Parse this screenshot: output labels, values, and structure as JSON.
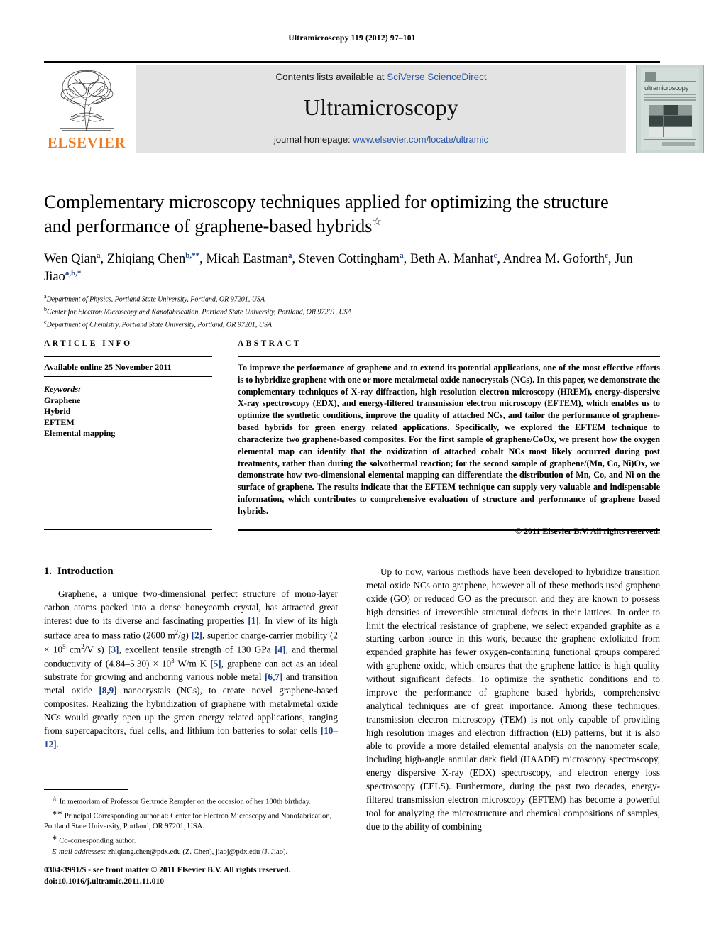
{
  "running_head": "Ultramicroscopy 119 (2012) 97–101",
  "masthead": {
    "contents_prefix": "Contents lists available at ",
    "contents_link": "SciVerse ScienceDirect",
    "journal_title": "Ultramicroscopy",
    "homepage_prefix": "journal homepage: ",
    "homepage_url": "www.elsevier.com/locate/ultramic",
    "publisher": "ELSEVIER",
    "publisher_color": "#ee7c24",
    "link_color": "#2b58a6",
    "cover": {
      "title": "ultramicroscopy",
      "subtitle": "a journal concerned with the problem of resolving atoms, molecules, tissues and structures in the microscopy"
    }
  },
  "article": {
    "title_line1": "Complementary microscopy techniques applied for optimizing the structure",
    "title_line2": "and performance of graphene-based hybrids",
    "title_footnote_mark": "☆",
    "authors": [
      {
        "name": "Wen Qian",
        "sup": "a",
        "sep": ", "
      },
      {
        "name": "Zhiqiang Chen",
        "sup": "b,**",
        "sep": ", "
      },
      {
        "name": "Micah Eastman",
        "sup": "a",
        "sep": ", "
      },
      {
        "name": "Steven Cottingham",
        "sup": "a",
        "sep": ", "
      },
      {
        "name": "Beth A. Manhat",
        "sup": "c",
        "sep": ", "
      },
      {
        "name": "Andrea M. Goforth",
        "sup": "c",
        "sep": ", "
      },
      {
        "name": "Jun Jiao",
        "sup": "a,b,*",
        "sep": ""
      }
    ],
    "affiliations": [
      {
        "mark": "a",
        "text": "Department of Physics, Portland State University, Portland, OR 97201, USA"
      },
      {
        "mark": "b",
        "text": "Center for Electron Microscopy and Nanofabrication, Portland State University, Portland, OR 97201, USA"
      },
      {
        "mark": "c",
        "text": "Department of Chemistry, Portland State University, Portland, OR 97201, USA"
      }
    ]
  },
  "article_info": {
    "heading": "ARTICLE INFO",
    "available_online": "Available online 25 November 2011",
    "keywords_label": "Keywords:",
    "keywords": [
      "Graphene",
      "Hybrid",
      "EFTEM",
      "Elemental mapping"
    ]
  },
  "abstract": {
    "heading": "ABSTRACT",
    "text": "To improve the performance of graphene and to extend its potential applications, one of the most effective efforts is to hybridize graphene with one or more metal/metal oxide nanocrystals (NCs). In this paper, we demonstrate the complementary techniques of X-ray diffraction, high resolution electron microscopy (HREM), energy-dispersive X-ray spectroscopy (EDX), and energy-filtered transmission electron microscopy (EFTEM), which enables us to optimize the synthetic conditions, improve the quality of attached NCs, and tailor the performance of graphene-based hybrids for green energy related applications. Specifically, we explored the EFTEM technique to characterize two graphene-based composites. For the first sample of graphene/CoOx, we present how the oxygen elemental map can identify that the oxidization of attached cobalt NCs most likely occurred during post treatments, rather than during the solvothermal reaction; for the second sample of graphene/(Mn, Co, Ni)Ox, we demonstrate how two-dimensional elemental mapping can differentiate the distribution of Mn, Co, and Ni on the surface of graphene. The results indicate that the EFTEM technique can supply very valuable and indispensable information, which contributes to comprehensive evaluation of structure and performance of graphene based hybrids.",
    "copyright": "© 2011 Elsevier B.V. All rights reserved."
  },
  "body": {
    "section_number": "1.",
    "section_title": "Introduction",
    "left_paragraph_html": "Graphene, a unique two-dimensional perfect structure of mono-layer carbon atoms packed into a dense honeycomb crystal, has attracted great interest due to its diverse and fascinating properties [1]. In view of its high surface area to mass ratio (2600 m2/g) [2], superior charge-carrier mobility (2 × 105 cm2/V s) [3], excellent tensile strength of 130 GPa [4], and thermal conductivity of (4.84–5.30) × 103 W/m K [5], graphene can act as an ideal substrate for growing and anchoring various noble metal [6,7] and transition metal oxide [8,9] nanocrystals (NCs), to create novel graphene-based composites. Realizing the hybridization of graphene with metal/metal oxide NCs would greatly open up the green energy related applications, ranging from supercapacitors, fuel cells, and lithium ion batteries to solar cells [10–12].",
    "right_paragraph_html": "Up to now, various methods have been developed to hybridize transition metal oxide NCs onto graphene, however all of these methods used graphene oxide (GO) or reduced GO as the precursor, and they are known to possess high densities of irreversible structural defects in their lattices. In order to limit the electrical resistance of graphene, we select expanded graphite as a starting carbon source in this work, because the graphene exfoliated from expanded graphite has fewer oxygen-containing functional groups compared with graphene oxide, which ensures that the graphene lattice is high quality without significant defects. To optimize the synthetic conditions and to improve the performance of graphene based hybrids, comprehensive analytical techniques are of great importance. Among these techniques, transmission electron microscopy (TEM) is not only capable of providing high resolution images and electron diffraction (ED) patterns, but it is also able to provide a more detailed elemental analysis on the nanometer scale, including high-angle annular dark field (HAADF) microscopy spectroscopy, energy dispersive X-ray (EDX) spectroscopy, and electron energy loss spectroscopy (EELS). Furthermore, during the past two decades, energy-filtered transmission electron microscopy (EFTEM) has become a powerful tool for analyzing the microstructure and chemical compositions of samples, due to the ability of combining"
  },
  "footnotes": [
    {
      "mark": "☆",
      "text": "In memoriam of Professor Gertrude Rempfer on the occasion of her 100th birthday."
    },
    {
      "mark": "∗∗",
      "text": "Principal Corresponding author at: Center for Electron Microscopy and Nanofabrication, Portland State University, Portland, OR 97201, USA."
    },
    {
      "mark": "∗",
      "text": "Co-corresponding author."
    }
  ],
  "email_footnote": {
    "label": "E-mail addresses:",
    "text": "zhiqiang.chen@pdx.edu (Z. Chen), jiaoj@pdx.edu (J. Jiao)."
  },
  "issn": {
    "line1": "0304-3991/$ - see front matter © 2011 Elsevier B.V. All rights reserved.",
    "line2": "doi:10.1016/j.ultramic.2011.11.010"
  }
}
